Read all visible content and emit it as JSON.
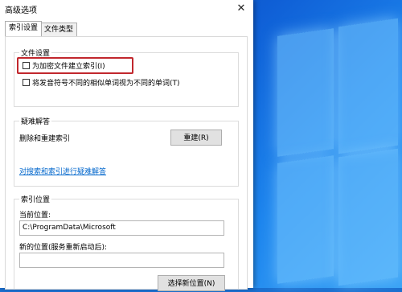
{
  "window": {
    "title": "高级选项",
    "close_glyph": "✕"
  },
  "tabs": [
    {
      "label": "索引设置",
      "active": true
    },
    {
      "label": "文件类型",
      "active": false
    }
  ],
  "file_settings": {
    "group_label": "文件设置",
    "encrypt_checkbox_label": "为加密文件建立索引(I)",
    "diacritics_checkbox_label": "将发音符号不同的相似单词视为不同的单词(T)"
  },
  "troubleshooting": {
    "group_label": "疑难解答",
    "rebuild_text": "删除和重建索引",
    "rebuild_button": "重建(R)",
    "troubleshoot_link": "对搜索和索引进行疑难解答"
  },
  "index_location": {
    "group_label": "索引位置",
    "current_label": "当前位置:",
    "current_value": "C:\\ProgramData\\Microsoft",
    "new_label": "新的位置(服务重新启动后):",
    "new_value": "",
    "select_button": "选择新位置(N)"
  },
  "colors": {
    "highlight": "#c1272d",
    "link": "#0066cc",
    "desktop": "#0f5fd6"
  }
}
